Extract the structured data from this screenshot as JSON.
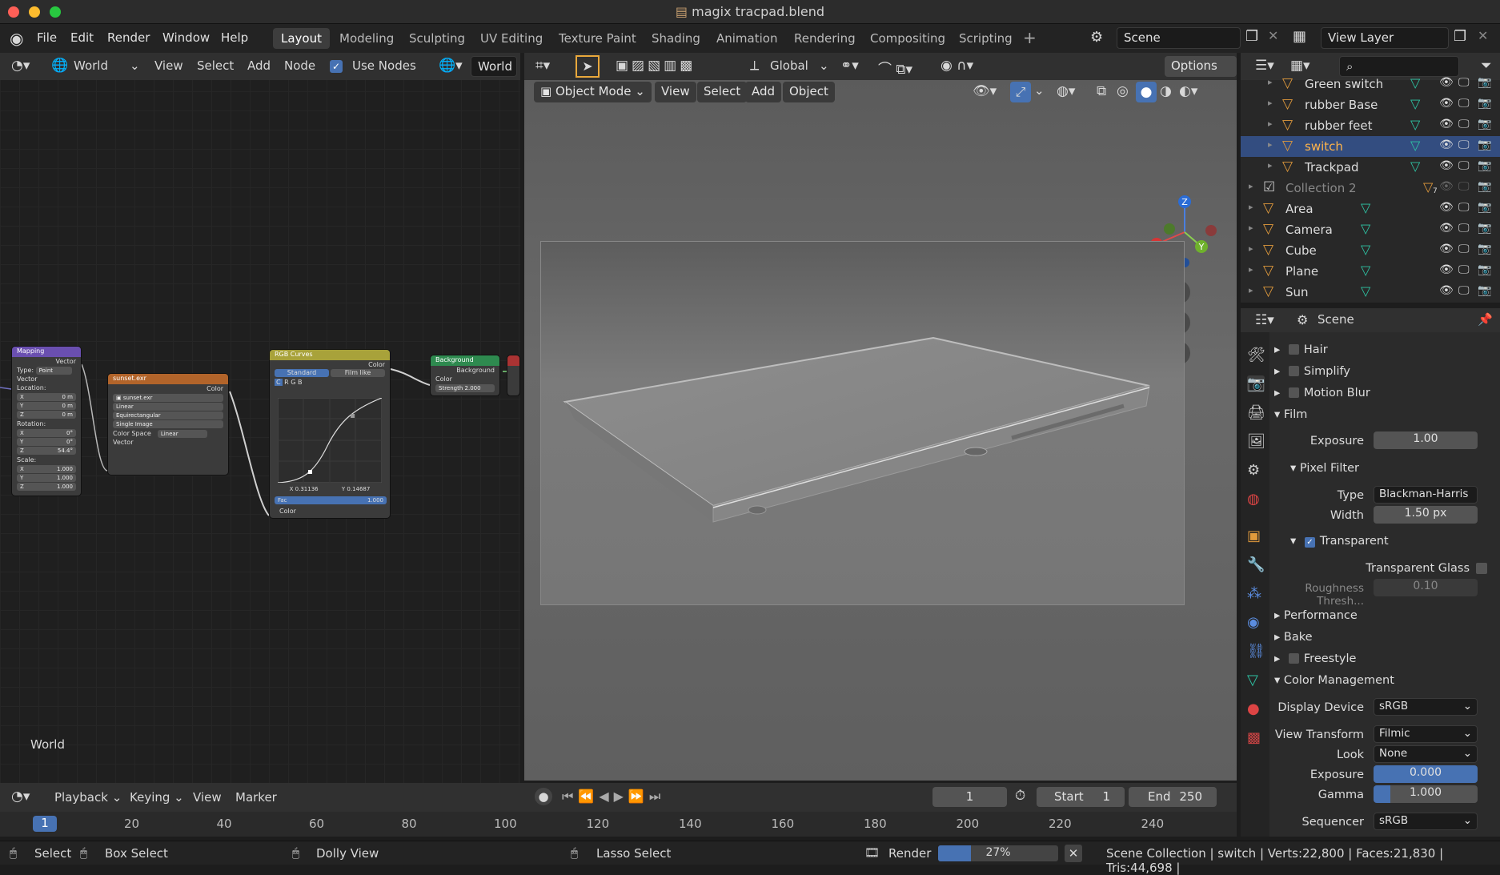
{
  "window": {
    "title": "magix tracpad.blend"
  },
  "menu": [
    "File",
    "Edit",
    "Render",
    "Window",
    "Help"
  ],
  "workspaces": [
    "Layout",
    "Modeling",
    "Sculpting",
    "UV Editing",
    "Texture Paint",
    "Shading",
    "Animation",
    "Rendering",
    "Compositing",
    "Scripting"
  ],
  "scene_field": "Scene",
  "view_layer_field": "View Layer",
  "node_editor": {
    "world_selector": "World",
    "view": "View",
    "select": "Select",
    "add": "Add",
    "node": "Node",
    "use_nodes": "Use Nodes",
    "world_field": "World",
    "corner_label": "World",
    "mapping": {
      "title": "Mapping",
      "vector_out": "Vector",
      "type_label": "Type:",
      "type_value": "Point",
      "vector_in": "Vector",
      "location": "Location:",
      "loc_x": "0 m",
      "loc_y": "0 m",
      "loc_z": "0 m",
      "rotation": "Rotation:",
      "rot_x": "0°",
      "rot_y": "0°",
      "rot_z": "54.4°",
      "scale": "Scale:",
      "sc_x": "1.000",
      "sc_y": "1.000",
      "sc_z": "1.000",
      "x": "X",
      "y": "Y",
      "z": "Z"
    },
    "sunset": {
      "title": "sunset.exr",
      "color_out": "Color",
      "file": "sunset.exr",
      "interp": "Linear",
      "proj": "Equirectangular",
      "src": "Single Image",
      "cs_label": "Color Space",
      "cs_value": "Linear",
      "vector_in": "Vector"
    },
    "curves": {
      "title": "RGB Curves",
      "color_out": "Color",
      "tab_standard": "Standard",
      "tab_film": "Film like",
      "c": "C",
      "r": "R",
      "g": "G",
      "b": "B",
      "xval": "X 0.31136",
      "yval": "Y 0.14687",
      "fac": "Fac",
      "fac_val": "1.000",
      "color_in": "Color"
    },
    "background": {
      "title": "Background",
      "out": "Background",
      "color": "Color",
      "strength": "Strength",
      "strength_val": "2.000"
    }
  },
  "viewport": {
    "mode": "Object Mode",
    "view": "View",
    "select": "Select",
    "add": "Add",
    "object": "Object",
    "orientation": "Global",
    "options": "Options",
    "axis_x": "X",
    "axis_y": "Y",
    "axis_z": "Z"
  },
  "outliner": {
    "items": [
      {
        "name": "Green switch",
        "indent": 1
      },
      {
        "name": "rubber Base",
        "indent": 1
      },
      {
        "name": "rubber feet",
        "indent": 1
      },
      {
        "name": "switch",
        "indent": 1,
        "selected": true
      },
      {
        "name": "Trackpad",
        "indent": 1
      },
      {
        "name": "Collection 2",
        "indent": 0,
        "collection": true,
        "badge": "7"
      },
      {
        "name": "Area",
        "indent": 0
      },
      {
        "name": "Camera",
        "indent": 0
      },
      {
        "name": "Cube",
        "indent": 0
      },
      {
        "name": "Plane",
        "indent": 0
      },
      {
        "name": "Sun",
        "indent": 0
      }
    ]
  },
  "properties": {
    "scene": "Scene",
    "hair": "Hair",
    "simplify": "Simplify",
    "motion_blur": "Motion Blur",
    "film": "Film",
    "exposure_label": "Exposure",
    "exposure": "1.00",
    "pixel_filter": "Pixel Filter",
    "type_label": "Type",
    "type": "Blackman-Harris",
    "width_label": "Width",
    "width": "1.50 px",
    "transparent": "Transparent",
    "transparent_glass": "Transparent Glass",
    "roughness_label": "Roughness Thresh...",
    "roughness": "0.10",
    "performance": "Performance",
    "bake": "Bake",
    "freestyle": "Freestyle",
    "color_management": "Color Management",
    "display_device_label": "Display Device",
    "display_device": "sRGB",
    "view_transform_label": "View Transform",
    "view_transform": "Filmic",
    "look_label": "Look",
    "look": "None",
    "cm_exposure_label": "Exposure",
    "cm_exposure": "0.000",
    "gamma_label": "Gamma",
    "gamma": "1.000",
    "sequencer_label": "Sequencer",
    "sequencer": "sRGB"
  },
  "timeline": {
    "playback": "Playback",
    "keying": "Keying",
    "view": "View",
    "marker": "Marker",
    "current": "1",
    "start_label": "Start",
    "start": "1",
    "end_label": "End",
    "end": "250",
    "frame_marker": "1",
    "ticks": [
      "20",
      "40",
      "60",
      "80",
      "100",
      "120",
      "140",
      "160",
      "180",
      "200",
      "220",
      "240"
    ]
  },
  "status": {
    "select": "Select",
    "box_select": "Box Select",
    "dolly": "Dolly View",
    "lasso": "Lasso Select",
    "render": "Render",
    "progress": "27%",
    "info": "Scene Collection | switch | Verts:22,800 | Faces:21,830 | Tris:44,698 |"
  },
  "colors": {
    "accent": "#4772b3",
    "selected_row": "#334d80",
    "object_icon": "#e09a3c",
    "mesh_icon": "#2ec5a5",
    "light_icon": "#8ad04f"
  }
}
